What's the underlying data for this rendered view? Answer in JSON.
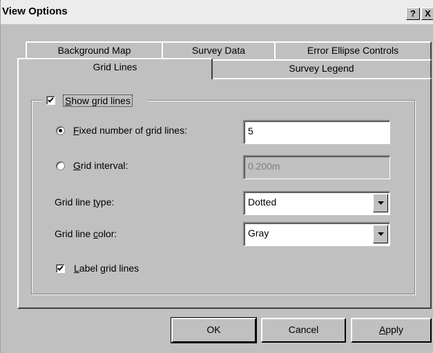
{
  "window": {
    "title": "View Options",
    "help_label": "?",
    "close_label": "X"
  },
  "tabs": {
    "back_row": [
      "Background Map",
      "Survey Data",
      "Error Ellipse Controls"
    ],
    "front_row": [
      "Grid Lines",
      "Survey Legend"
    ],
    "active": "Grid Lines"
  },
  "grid": {
    "show_grid_lines": {
      "label_u": "S",
      "label_rest": "how grid lines",
      "checked": true
    },
    "fixed_number": {
      "label_u": "F",
      "label_rest": "ixed number of grid lines:",
      "selected": true,
      "value": "5"
    },
    "grid_interval": {
      "label_u": "G",
      "label_rest": "rid interval:",
      "selected": false,
      "value": "0.200m"
    },
    "line_type": {
      "label_pre": "Grid line ",
      "label_u": "t",
      "label_post": "ype:",
      "value": "Dotted"
    },
    "line_color": {
      "label_pre": "Grid line ",
      "label_u": "c",
      "label_post": "olor:",
      "value": "Gray"
    },
    "label_lines": {
      "label_u": "L",
      "label_rest": "abel grid lines",
      "checked": true
    }
  },
  "buttons": {
    "ok": "OK",
    "cancel": "Cancel",
    "apply_u": "A",
    "apply_rest": "pply"
  }
}
